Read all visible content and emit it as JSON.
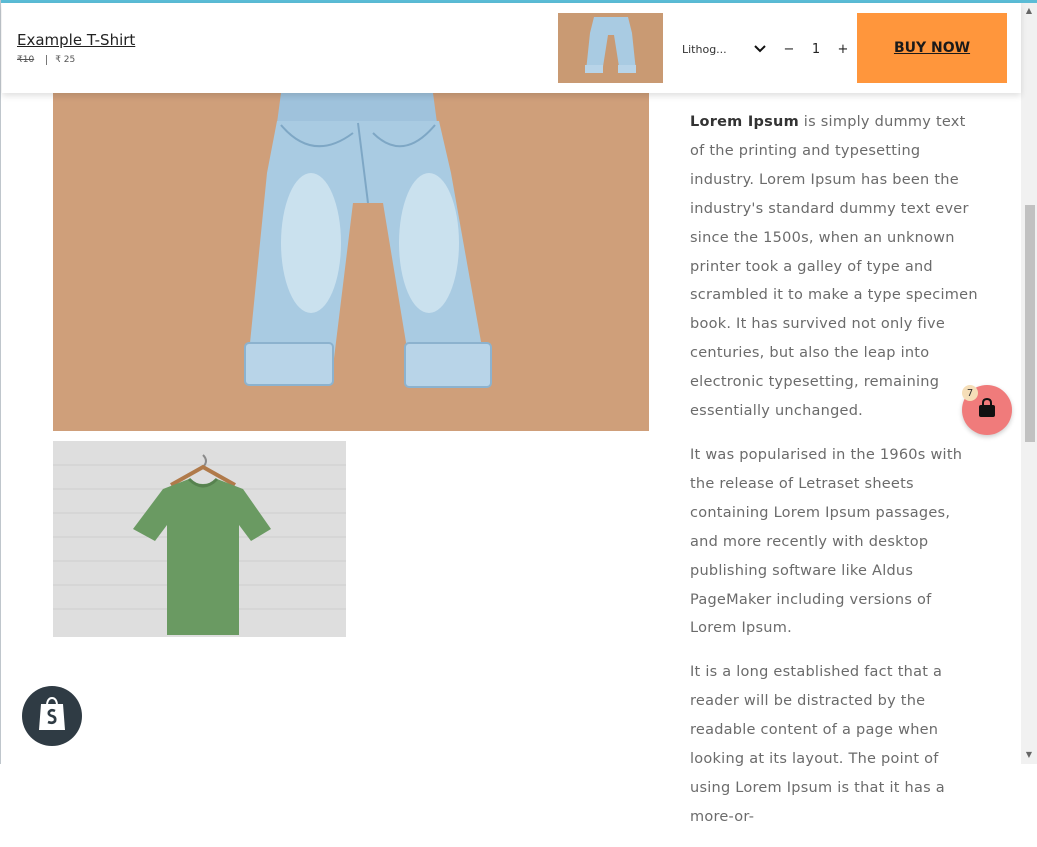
{
  "sticky_bar": {
    "title": "Example T-Shirt",
    "old_price": "₹10",
    "price": "₹ 25",
    "variant": "Lithog...",
    "quantity": "1",
    "minus": "−",
    "plus": "+",
    "buy_now": "BUY NOW"
  },
  "description": {
    "p1_bold": "Lorem Ipsum",
    "p1_rest": " is simply dummy text of the printing and typesetting industry. Lorem Ipsum has been the industry's standard dummy text ever since the 1500s, when an unknown printer took a galley of type and scrambled it to make a type specimen book. It has survived not only five centuries, but also the leap into electronic typesetting, remaining essentially unchanged.",
    "p2": "It was popularised in the 1960s with the release of Letraset sheets containing Lorem Ipsum passages, and more recently with desktop publishing software like Aldus PageMaker including versions of Lorem Ipsum.",
    "p3": "It is a long established fact that a reader will be distracted by the readable content of a page when looking at its layout. The point of using Lorem Ipsum is that it has a more-or-"
  },
  "cart": {
    "count": "7",
    "icon": "shopping-bag-icon"
  },
  "badge": {
    "icon": "shopify-bag-icon"
  },
  "colors": {
    "buy_button": "#ff963c",
    "cart_fab": "#f07b7b",
    "badge": "#2f3b44",
    "top_accent": "#5bbcd6"
  }
}
